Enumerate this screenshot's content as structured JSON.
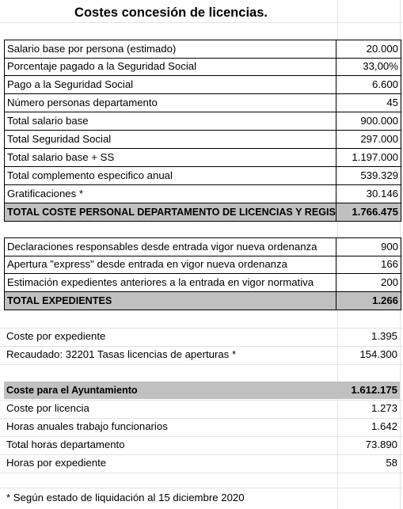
{
  "title": "Costes concesión de licencias.",
  "block1": [
    {
      "label": "Salario base por persona (estimado)",
      "value": "20.000"
    },
    {
      "label": "Porcentaje pagado a la Seguridad Social",
      "value": "33,00%"
    },
    {
      "label": "Pago a la Seguridad Social",
      "value": "6.600"
    },
    {
      "label": "Número personas departamento",
      "value": "45"
    },
    {
      "label": "Total salario base",
      "value": "900.000"
    },
    {
      "label": "Total Seguridad Social",
      "value": "297.000"
    },
    {
      "label": "Total salario base + SS",
      "value": "1.197.000"
    },
    {
      "label": "Total complemento especifico anual",
      "value": "539.329"
    },
    {
      "label": "Gratificaciones *",
      "value": "30.146"
    }
  ],
  "total1": {
    "label": "TOTAL COSTE PERSONAL DEPARTAMENTO DE LICENCIAS Y REGISTRO",
    "value": "1.766.475"
  },
  "block2": [
    {
      "label": "Declaraciones responsables desde entrada vigor nueva ordenanza",
      "value": "900"
    },
    {
      "label": "Apertura \"express\" desde entrada en vigor nueva ordenanza",
      "value": "166"
    },
    {
      "label": "Estimación expedientes anteriores a la entrada en vigor normativa",
      "value": "200"
    }
  ],
  "total2": {
    "label": "TOTAL EXPEDIENTES",
    "value": "1.266"
  },
  "block3": [
    {
      "label": "Coste por expediente",
      "value": "1.395"
    },
    {
      "label": "Recaudado: 32201 Tasas licencias de aperturas *",
      "value": "154.300"
    }
  ],
  "total3": {
    "label": "Coste para el Ayuntamiento",
    "value": "1.612.175"
  },
  "block4": [
    {
      "label": "Coste por licencia",
      "value": "1.273"
    },
    {
      "label": "Horas anuales trabajo funcionarios",
      "value": "1.642"
    },
    {
      "label": "Total horas departamento",
      "value": "73.890"
    },
    {
      "label": "Horas por expediente",
      "value": "58"
    }
  ],
  "footnote": "* Según estado de liquidación al 15 diciembre 2020"
}
